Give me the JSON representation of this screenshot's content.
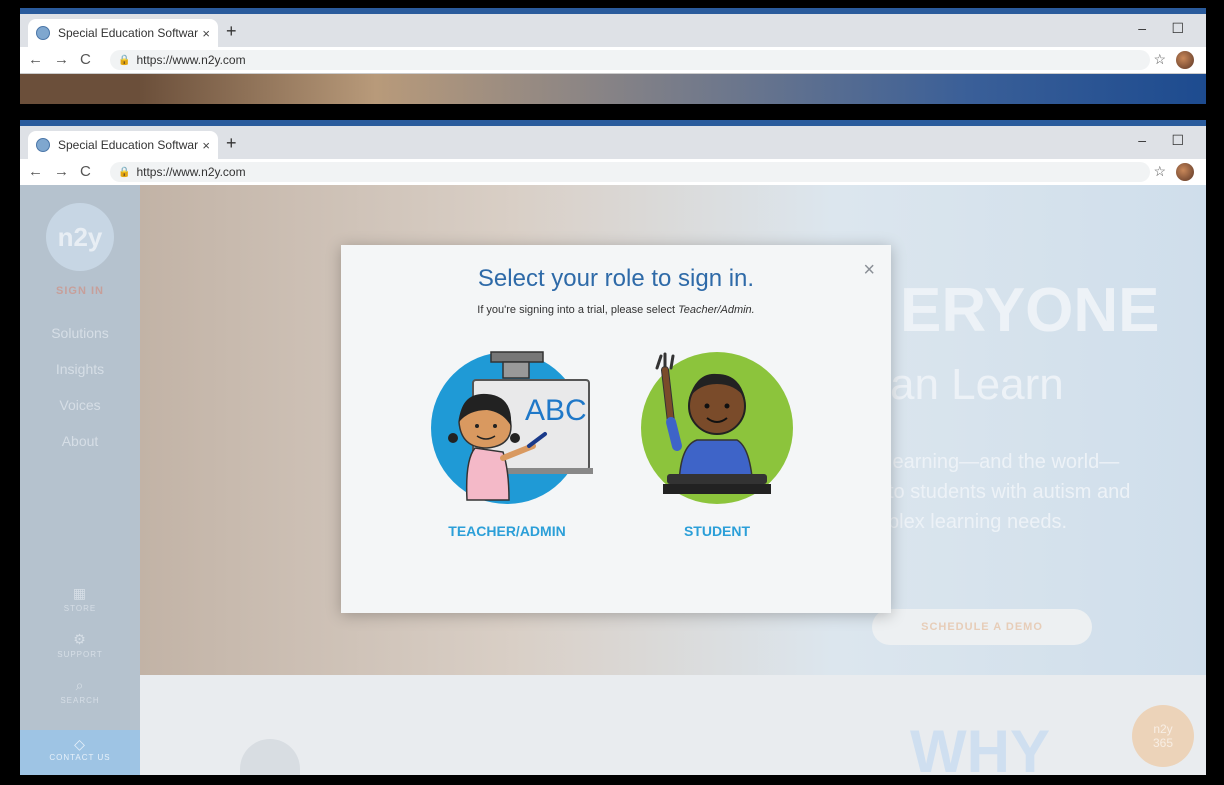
{
  "browser": {
    "tab_title": "Special Education Software, Curri",
    "tab_close": "×",
    "new_tab": "+",
    "url": "https://www.n2y.com",
    "minimize": "–",
    "maximize": "☐"
  },
  "sidebar": {
    "logo": "n2y",
    "sign_in": "SIGN IN",
    "items": [
      "Solutions",
      "Insights",
      "Voices",
      "About"
    ],
    "tools": [
      "STORE",
      "SUPPORT",
      "SEARCH"
    ],
    "contact": "CONTACT US"
  },
  "hero": {
    "headline": "ERYONE",
    "subhead": "an Learn",
    "body_lines": [
      "learning—and the world—",
      "to students with autism and",
      "plex learning needs."
    ],
    "cta": "SCHEDULE A DEMO"
  },
  "lower": {
    "why": "WHY",
    "badge_line1": "n2y",
    "badge_line2": "365"
  },
  "modal": {
    "title": "Select your role to sign in.",
    "subtitle_prefix": "If you're signing into a trial, please select ",
    "subtitle_emphasis": "Teacher/Admin.",
    "close": "×",
    "roles": [
      {
        "label": "TEACHER/ADMIN",
        "board_text": "ABC"
      },
      {
        "label": "STUDENT"
      }
    ]
  },
  "colors": {
    "accent_blue": "#2e6aa8",
    "role_label": "#2b9fd8",
    "teacher_bg": "#1f9ad6",
    "student_bg": "#8cc43c"
  }
}
